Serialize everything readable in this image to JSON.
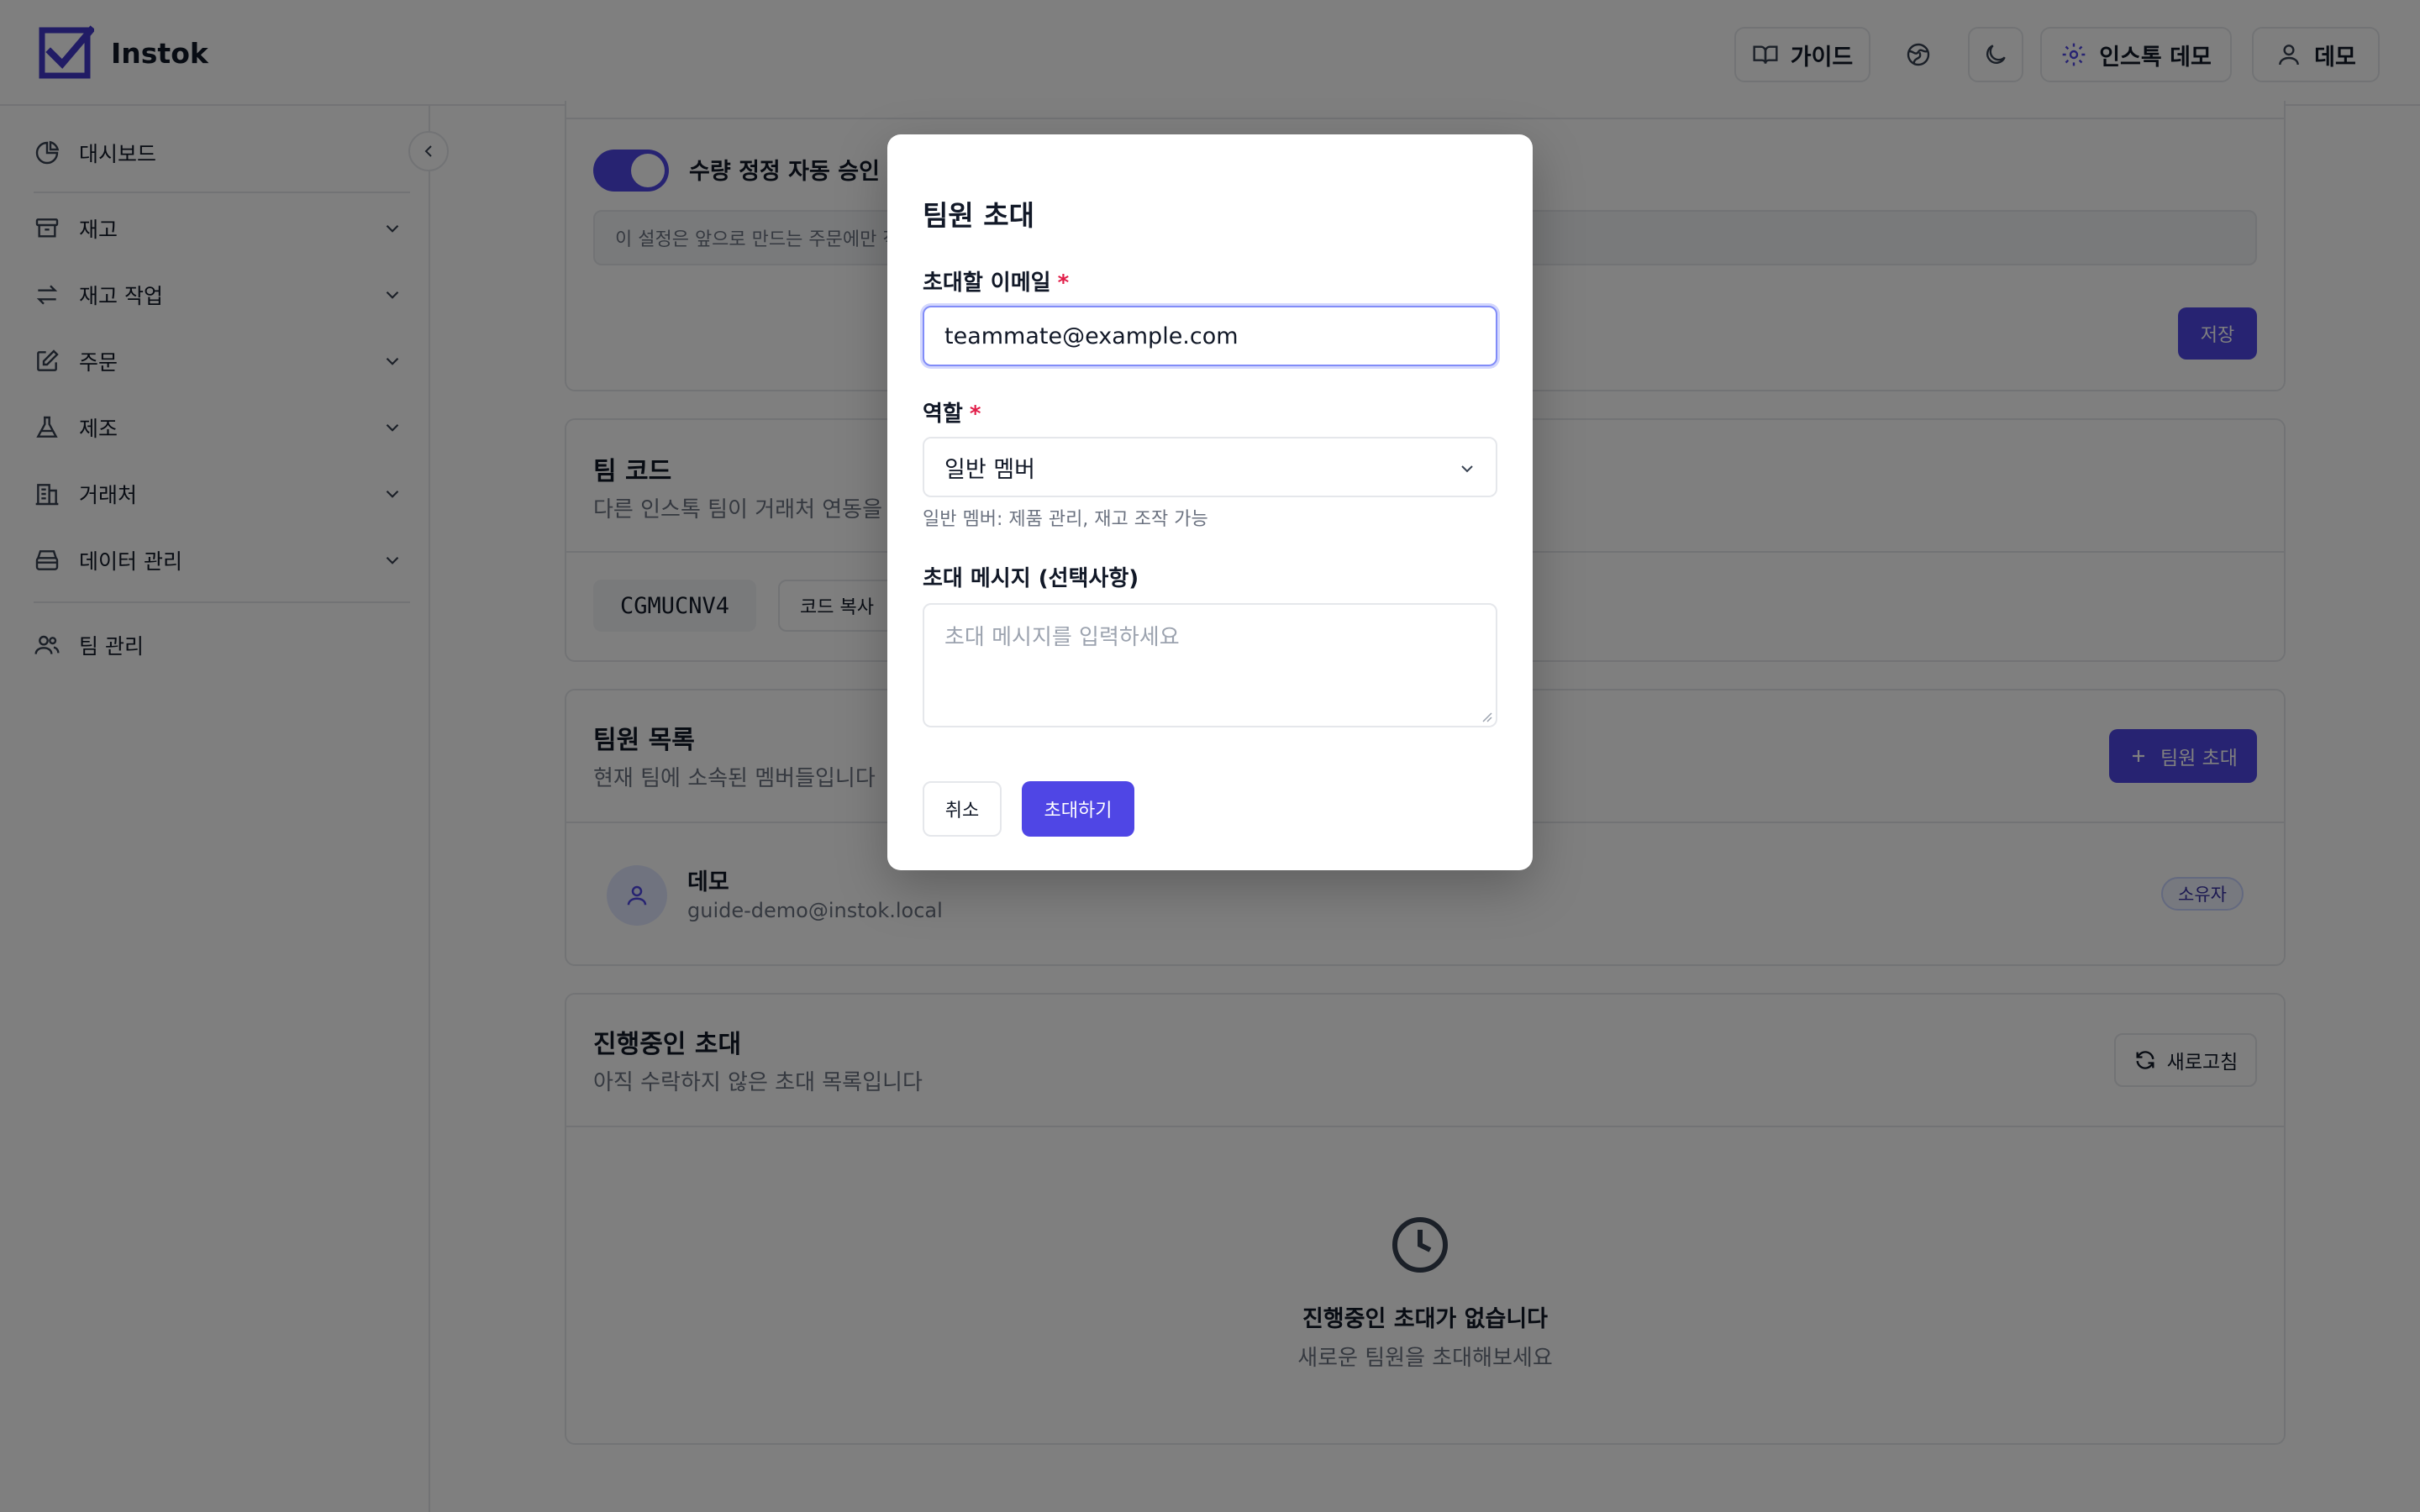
{
  "app": {
    "name": "Instok"
  },
  "header": {
    "guide_label": "가이드",
    "workspace_label": "인스톡 데모",
    "user_label": "데모"
  },
  "sidebar": {
    "items": [
      {
        "label": "대시보드",
        "icon": "pie-chart-icon",
        "expandable": false
      },
      {
        "label": "재고",
        "icon": "archive-icon",
        "expandable": true
      },
      {
        "label": "재고 작업",
        "icon": "transfer-arrows-icon",
        "expandable": true
      },
      {
        "label": "주문",
        "icon": "edit-icon",
        "expandable": true
      },
      {
        "label": "제조",
        "icon": "flask-icon",
        "expandable": true
      },
      {
        "label": "거래처",
        "icon": "building-icon",
        "expandable": true
      },
      {
        "label": "데이터 관리",
        "icon": "database-icon",
        "expandable": true
      },
      {
        "label": "팀 관리",
        "icon": "users-icon",
        "expandable": false
      }
    ]
  },
  "settings": {
    "toggle_label": "수량 정정 자동 승인",
    "toggle_on": true,
    "note": "이 설정은 앞으로 만드는 주문에만 적용됩니다",
    "save_label": "저장"
  },
  "team_code": {
    "title": "팀 코드",
    "subtitle": "다른 인스톡 팀이 거래처 연동을 요청할 때 이 코드를 사용합니다",
    "code": "CGMUCNV4",
    "copy_label": "코드 복사"
  },
  "members": {
    "title": "팀원 목록",
    "subtitle": "현재 팀에 소속된 멤버들입니다",
    "invite_label": "팀원 초대",
    "list": [
      {
        "name": "데모",
        "email": "guide-demo@instok.local",
        "role": "소유자"
      }
    ]
  },
  "pending": {
    "title": "진행중인 초대",
    "subtitle": "아직 수락하지 않은 초대 목록입니다",
    "refresh_label": "새로고침",
    "empty_title": "진행중인 초대가 없습니다",
    "empty_sub": "새로운 팀원을 초대해보세요"
  },
  "modal": {
    "title": "팀원 초대",
    "email_label": "초대할 이메일",
    "email_value": "teammate@example.com",
    "role_label": "역할",
    "role_value": "일반 멤버",
    "role_hint": "일반 멤버: 제품 관리, 재고 조작 가능",
    "message_label": "초대 메시지 (선택사항)",
    "message_placeholder": "초대 메시지를 입력하세요",
    "required_mark": "*",
    "cancel_label": "취소",
    "submit_label": "초대하기"
  },
  "colors": {
    "accent": "#4f46e5",
    "required": "#e11d48"
  }
}
